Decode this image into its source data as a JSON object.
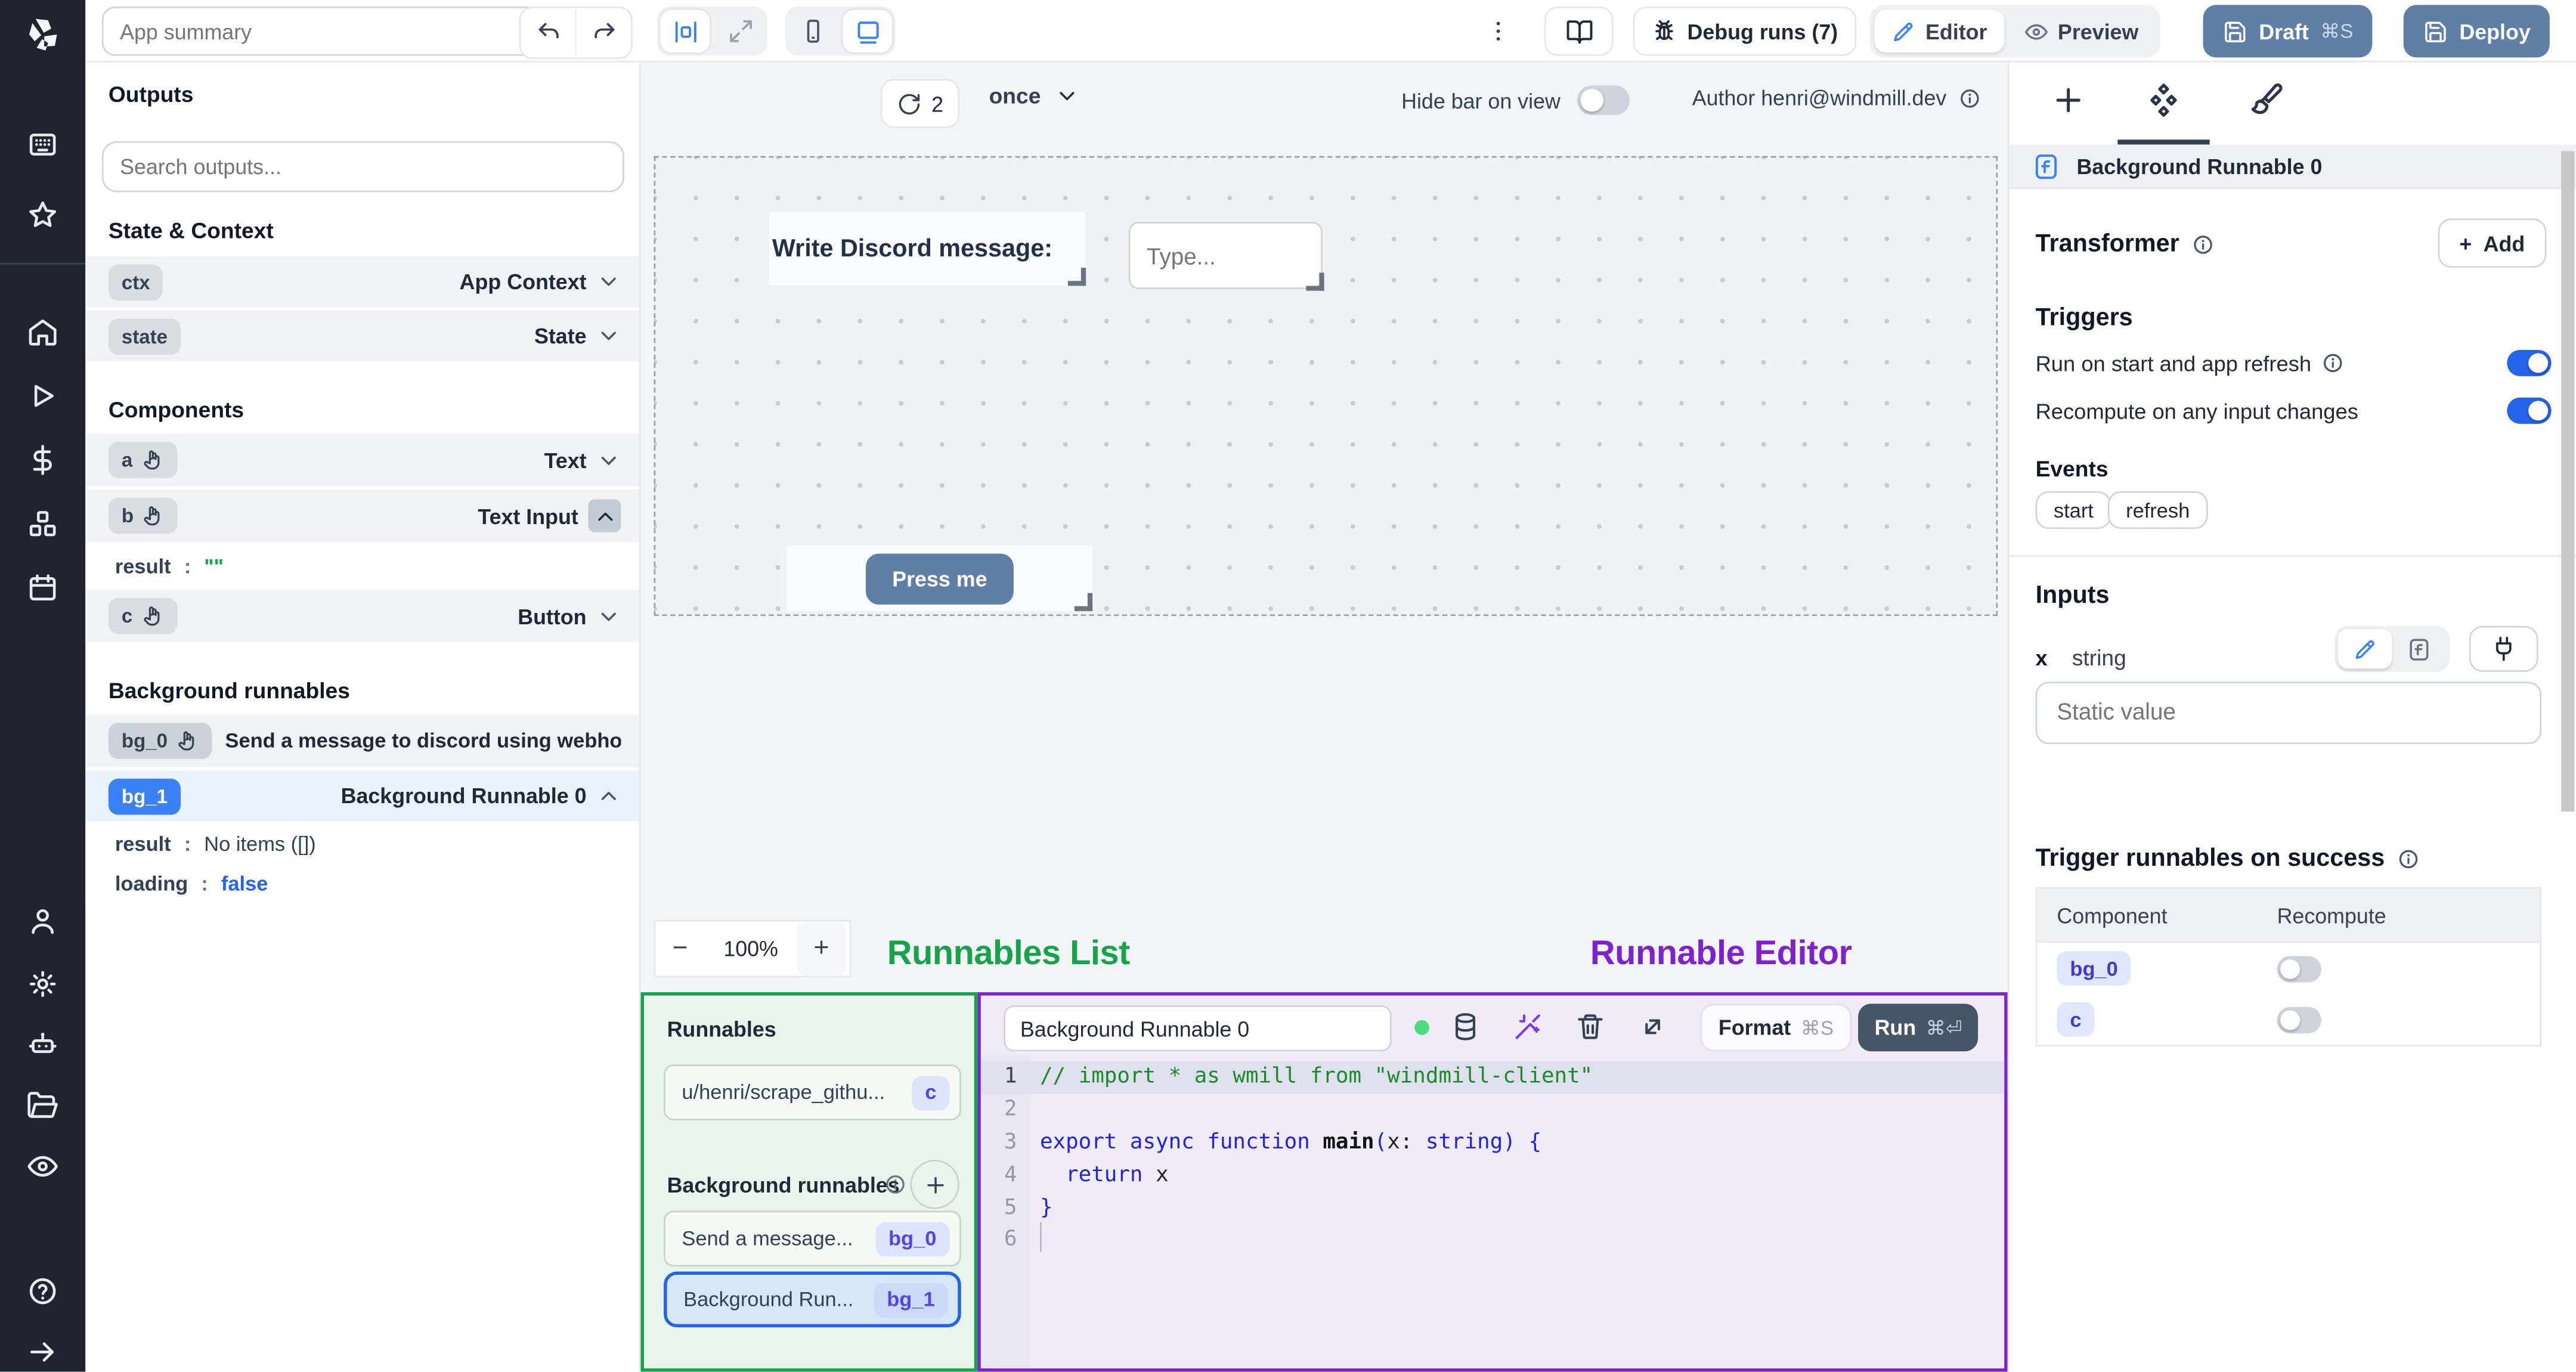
{
  "colors": {
    "accent_blue": "#3b82f6",
    "selected_border": "#2563eb",
    "slate_button": "#5f7fa7",
    "annotation_green": "#16a34a",
    "annotation_purple": "#7e22ce",
    "success_dot": "#4ade80",
    "toggle_on": "#2563eb"
  },
  "topbar": {
    "app_summary_placeholder": "App summary",
    "debug_runs_label": "Debug runs (7)",
    "editor_label": "Editor",
    "preview_label": "Preview",
    "draft_label": "Draft",
    "draft_shortcut": "⌘S",
    "deploy_label": "Deploy"
  },
  "outputs": {
    "title": "Outputs",
    "search_placeholder": "Search outputs...",
    "state_context_title": "State & Context",
    "ctx_badge": "ctx",
    "ctx_label": "App Context",
    "state_badge": "state",
    "state_label": "State",
    "components_title": "Components",
    "a_badge": "a",
    "a_label": "Text",
    "b_badge": "b",
    "b_label": "Text Input",
    "b_result_key": "result",
    "b_result_sep": ":",
    "b_result_value": "\"\"",
    "c_badge": "c",
    "c_label": "Button",
    "bg_title": "Background runnables",
    "bg0_badge": "bg_0",
    "bg0_label": "Send a message to discord using webhoo",
    "bg1_badge": "bg_1",
    "bg1_label": "Background Runnable 0",
    "bg1_result_key": "result",
    "bg1_result_sep": ":",
    "bg1_result_value": "No items ([])",
    "bg1_loading_key": "loading",
    "bg1_loading_sep": ":",
    "bg1_loading_value": "false"
  },
  "canvas": {
    "refresh_count": "2",
    "frequency": "once",
    "hide_bar_label": "Hide bar on view",
    "author_label": "Author henri@windmill.dev",
    "text_component": "Write Discord message:",
    "input_placeholder": "Type...",
    "button_label": "Press me",
    "zoom_minus": "−",
    "zoom_level": "100%",
    "zoom_plus": "+",
    "annotation_runnables_list": "Runnables List",
    "annotation_runnable_editor": "Runnable Editor"
  },
  "runnables_panel": {
    "title": "Runnables",
    "item0_label": "u/henri/scrape_githu...",
    "item0_badge": "c",
    "bg_title": "Background runnables",
    "item1_label": "Send a message...",
    "item1_badge": "bg_0",
    "item2_label": "Background Run...",
    "item2_badge": "bg_1"
  },
  "editor_panel": {
    "name_value": "Background Runnable 0",
    "format_label": "Format",
    "format_shortcut": "⌘S",
    "run_label": "Run",
    "run_shortcut": "⌘⏎",
    "code": [
      {
        "n": "1",
        "tokens": [
          "// import * as wmill from \"windmill-client\""
        ]
      },
      {
        "n": "2",
        "tokens": []
      },
      {
        "n": "3",
        "tokens": [
          "export async function ",
          "main",
          "(",
          "x: ",
          "string",
          ") {"
        ]
      },
      {
        "n": "4",
        "tokens": [
          "  return",
          " x"
        ]
      },
      {
        "n": "5",
        "tokens": [
          "}"
        ]
      },
      {
        "n": "6",
        "tokens": []
      }
    ]
  },
  "right_panel": {
    "header_title": "Background Runnable 0",
    "transformer_title": "Transformer",
    "add_plus": "+",
    "add_label": "Add",
    "triggers_title": "Triggers",
    "run_on_start_label": "Run on start and app refresh",
    "recompute_label": "Recompute on any input changes",
    "events_title": "Events",
    "event_start": "start",
    "event_refresh": "refresh",
    "inputs_title": "Inputs",
    "field_name": "x",
    "field_type": "string",
    "static_placeholder": "Static value",
    "trigger_success_title": "Trigger runnables on success",
    "col_component": "Component",
    "col_recompute": "Recompute",
    "row0_badge": "bg_0",
    "row1_badge": "c"
  }
}
